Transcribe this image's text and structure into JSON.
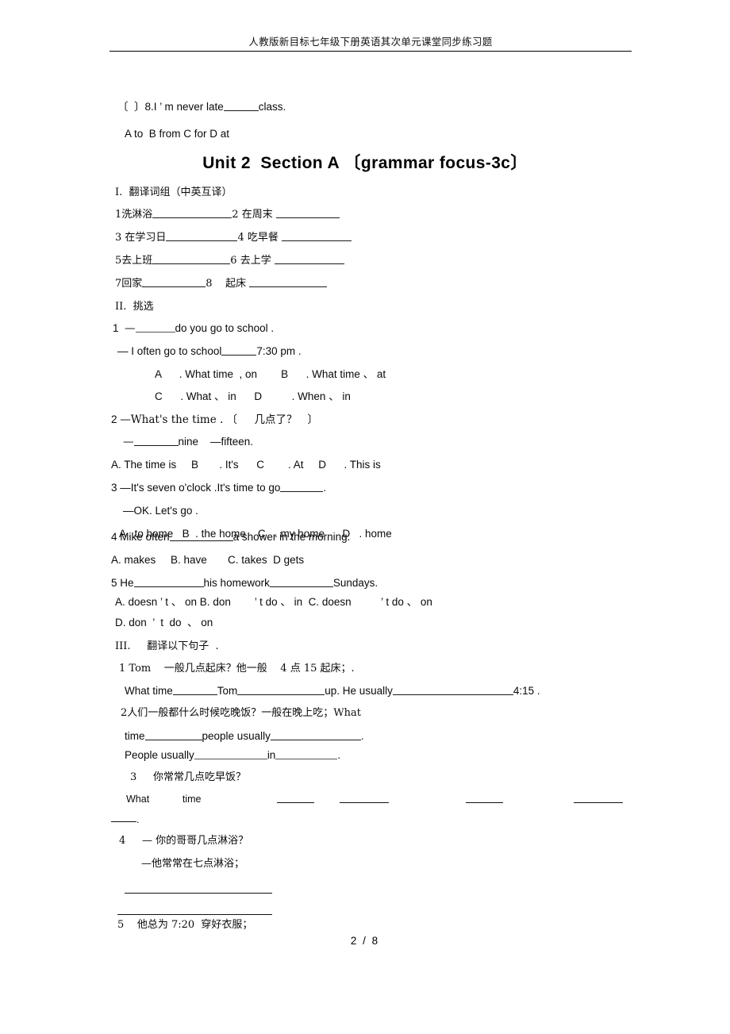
{
  "document": {
    "header_title": "人教版新目标七年级下册英语其次单元课堂同步练习题",
    "page_footer": "2 / 8",
    "title": "Unit 2  Section A 〔grammar focus-3c〕"
  },
  "carryover": {
    "question": "〔  〕8.I ’ m never late",
    "question_tail": "class.",
    "options": "A to  B from C for D at"
  },
  "section_one": {
    "heading": "I.  翻译词组（中英互译）",
    "items": [
      {
        "num": "1",
        "text": "洗淋浴"
      },
      {
        "num": "2",
        "text": "在周末 "
      },
      {
        "num": "3",
        "text": "在学习日"
      },
      {
        "num": "4",
        "text": "吃早餐 "
      },
      {
        "num": "5",
        "text": "去上班"
      },
      {
        "num": "6",
        "text": "去上学 "
      },
      {
        "num": "7",
        "text": "回家"
      },
      {
        "num": "8",
        "text": "起床 "
      }
    ]
  },
  "section_two": {
    "heading": "II.  挑选",
    "q1": {
      "num": "1",
      "stem_pre": "—",
      "stem_post": "do you go to school .",
      "reply_pre": "— I often go to school",
      "reply_post": "7:30 pm .",
      "optA_label": "A",
      "optA_text": ". What time  , on",
      "optB_label": "B",
      "optB_text": ". What time 、 at",
      "optC_label": "C",
      "optC_text": ". What 、 in",
      "optD_label": "D",
      "optD_text": ". When 、 in"
    },
    "q2": {
      "num": "2",
      "stem": "—What's the time . 〔     几点了？   〕",
      "reply_pre": "—",
      "reply_post": "nine    —fifteen.",
      "optA": "A. The time is",
      "optB_label": "B",
      "optB_text": ". It's",
      "optC_label": "C",
      "optC_text": ". At",
      "optD_label": "D",
      "optD_text": ". This is"
    },
    "q3": {
      "num": "3",
      "stem_pre": "—It's seven o'clock .It's time to go",
      "stem_post": ".",
      "reply": "—OK. Let's go .",
      "optA_label": "A",
      "optA_text": ". to home",
      "optB_label": "B",
      "optB_text": ". the home",
      "optC_label": "C",
      "optC_text": ". my home",
      "optD_label": "D",
      "optD_text": ". home"
    },
    "q4": {
      "num": "4",
      "stem_pre": "Mike often",
      "stem_post": "a shower in the morning.",
      "options": "A. makes     B. have       C. takes  D gets"
    },
    "q5": {
      "num": "5",
      "stem_pre": "He",
      "stem_mid": "his homework",
      "stem_post": "Sundays.",
      "options_line1": "A. doesn ’ t 、 on B. don        ’ t do 、 in  C. doesn          ’ t do 、 on",
      "options_line2": "D. don  ’  t  do  、 on"
    }
  },
  "section_three": {
    "heading": "III.     翻译以下句子  .",
    "q1": {
      "num": "1",
      "prompt": "Tom    一般几点起床？他一般    4 点 15 起床；.",
      "answer_a": "What time",
      "answer_b": "Tom",
      "answer_c": "up. He usually",
      "answer_d": "4:15 ."
    },
    "q2": {
      "num": "2",
      "prompt": "人们一般都什么时候吃晚饭？一般在晚上吃；What",
      "line1_a": "time",
      "line1_b": "people usually",
      "line1_c": ".",
      "line2_a": "People usually",
      "line2_b": "in",
      "line2_c": "."
    },
    "q3": {
      "num": "3",
      "prompt": "你常常几点吃早饭？",
      "answer_a": "What",
      "answer_b": "time",
      "answer_tail": "."
    },
    "q4": {
      "num": "4",
      "prompt": "— 你的哥哥几点淋浴？",
      "reply": "—他常常在七点淋浴；"
    },
    "q5": {
      "num": "5",
      "prompt": "他总为 7:20  穿好衣服；"
    }
  }
}
